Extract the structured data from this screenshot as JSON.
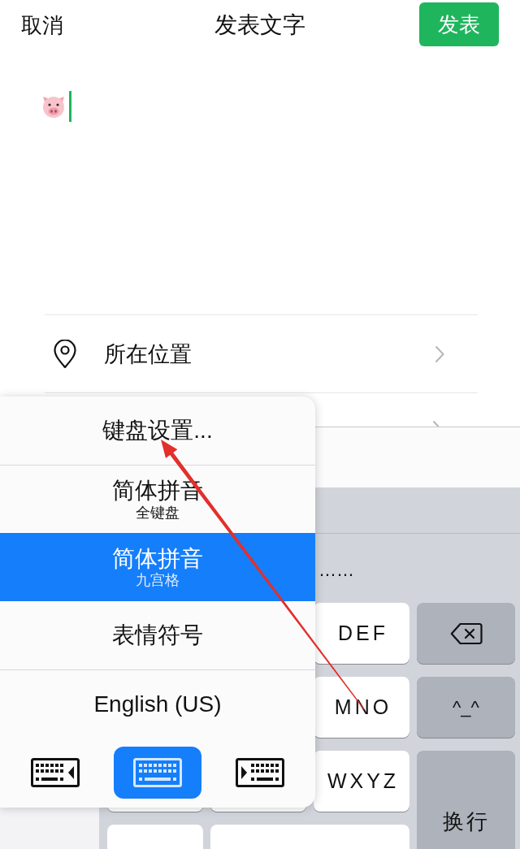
{
  "nav_bar": {
    "cancel_label": "取消",
    "title": "发表文字",
    "publish_label": "发表"
  },
  "composer": {
    "focused": true
  },
  "options": [
    {
      "label": "所在位置"
    }
  ],
  "keyboard": {
    "candidate_text": "……",
    "letter_keys": [
      "DEF",
      "MNO",
      "WXYZ"
    ],
    "side_keys": [
      {
        "kind": "delete"
      },
      {
        "kind": "emoticon",
        "label": "^_^"
      },
      {
        "kind": "return",
        "label": "换行"
      }
    ]
  },
  "input_menu": {
    "items": [
      {
        "label": "键盘设置...",
        "selected": false
      },
      {
        "label": "简体拼音",
        "sublabel": "全键盘",
        "selected": false
      },
      {
        "label": "简体拼音",
        "sublabel": "九宫格",
        "selected": true
      },
      {
        "label": "表情符号",
        "selected": false
      },
      {
        "label": "English (US)",
        "selected": false
      }
    ],
    "keyboard_modes": [
      {
        "kind": "left",
        "selected": false
      },
      {
        "kind": "full",
        "selected": true
      },
      {
        "kind": "right",
        "selected": false
      }
    ]
  }
}
